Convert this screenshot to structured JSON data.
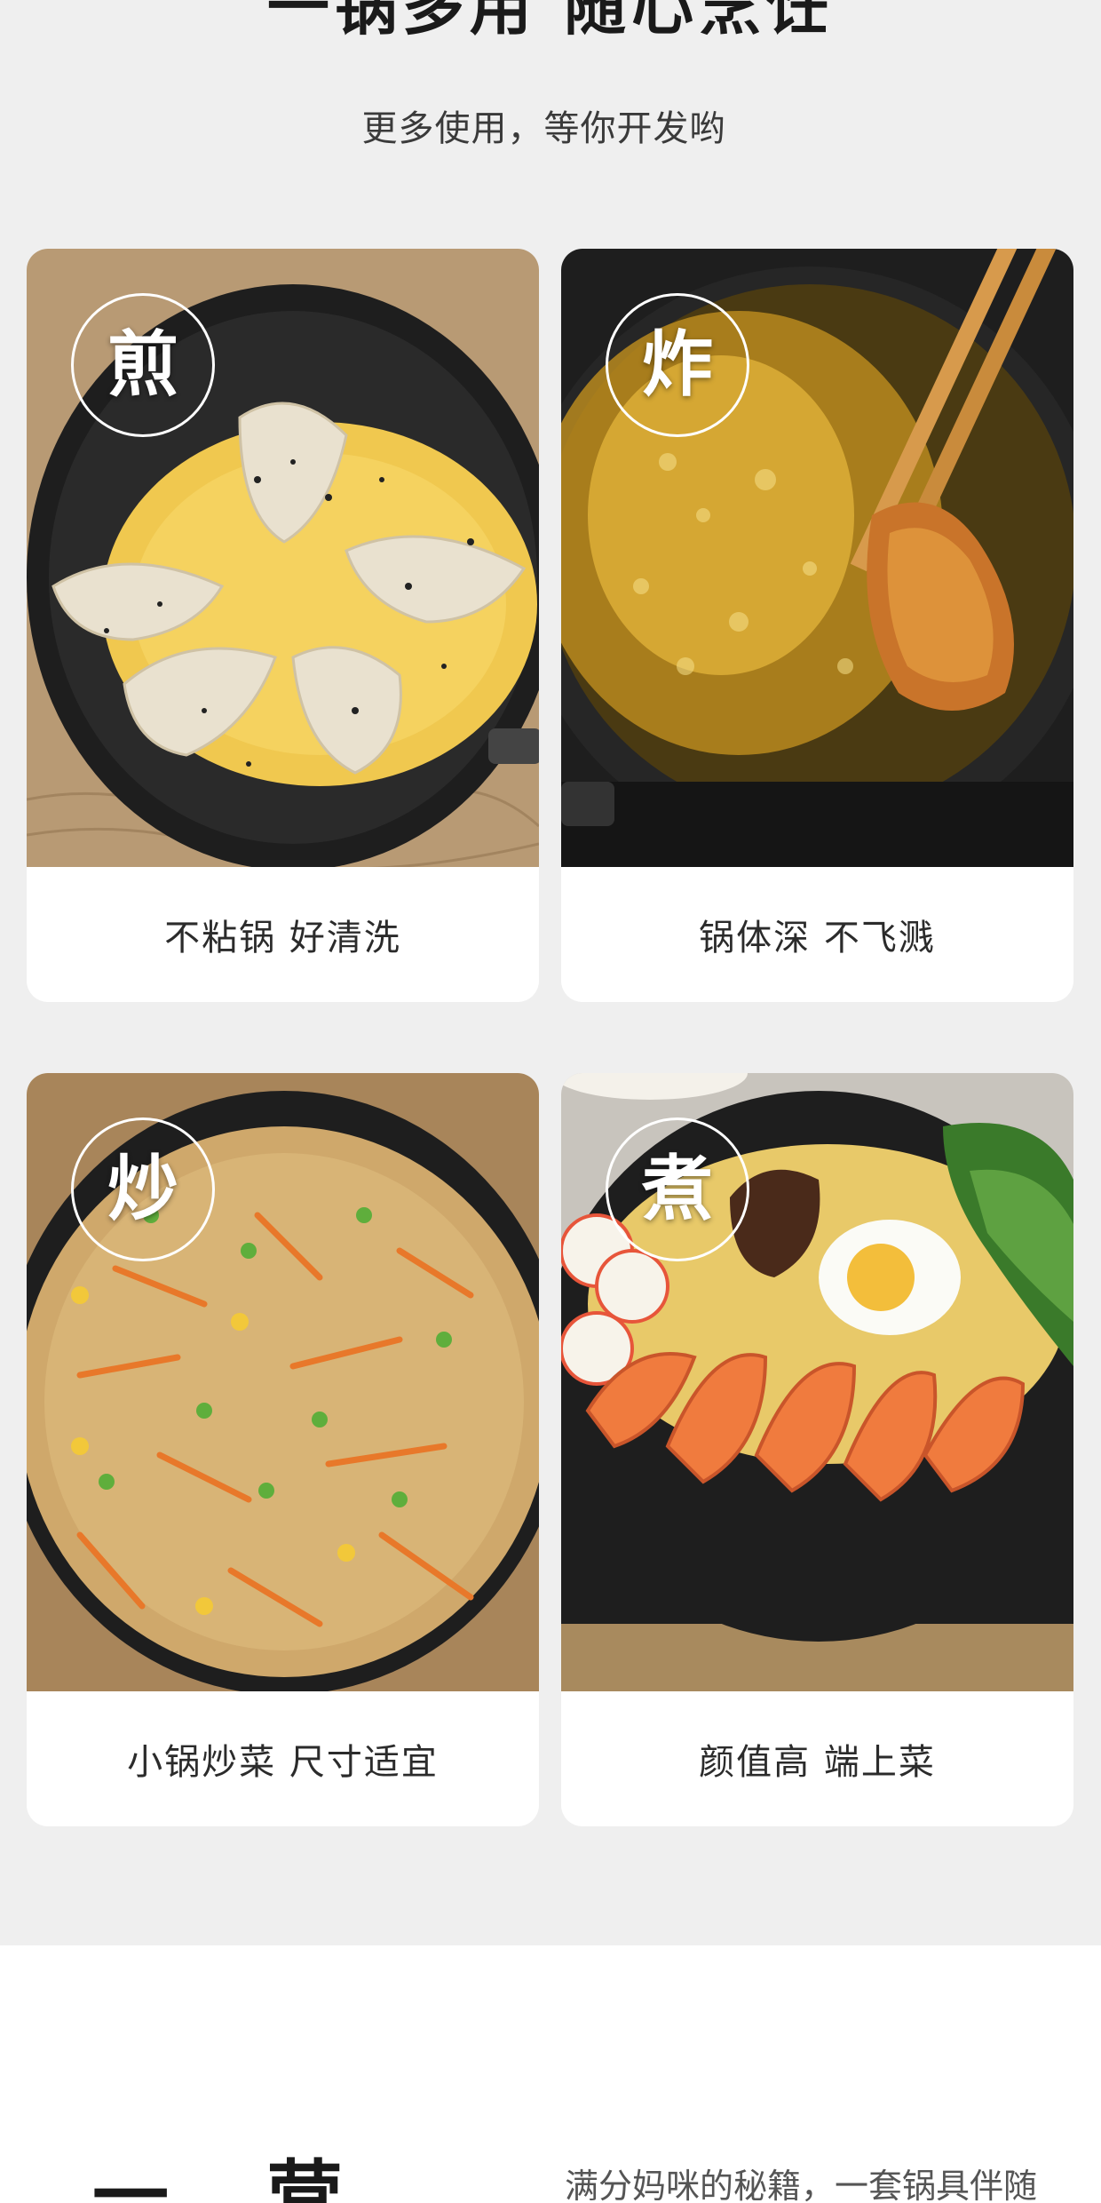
{
  "header": {
    "headline": "一锅多用 随心烹饪",
    "subline": "更多使用，等你开发哟"
  },
  "cards": [
    {
      "badge": "煎",
      "caption": "不粘锅 好清洗"
    },
    {
      "badge": "炸",
      "caption": "锅体深 不飞溅"
    },
    {
      "badge": "炒",
      "caption": "小锅炒菜 尺寸适宜"
    },
    {
      "badge": "煮",
      "caption": "颜值高 端上菜"
    }
  ],
  "footer": {
    "left_title": "一 营",
    "right_text": "满分妈咪的秘籍，一套锅具伴随"
  },
  "colors": {
    "page_bg": "#efefef",
    "card_bg": "#ffffff",
    "text_dark": "#1a1a1a",
    "pan_black": "#1e1e1e"
  }
}
